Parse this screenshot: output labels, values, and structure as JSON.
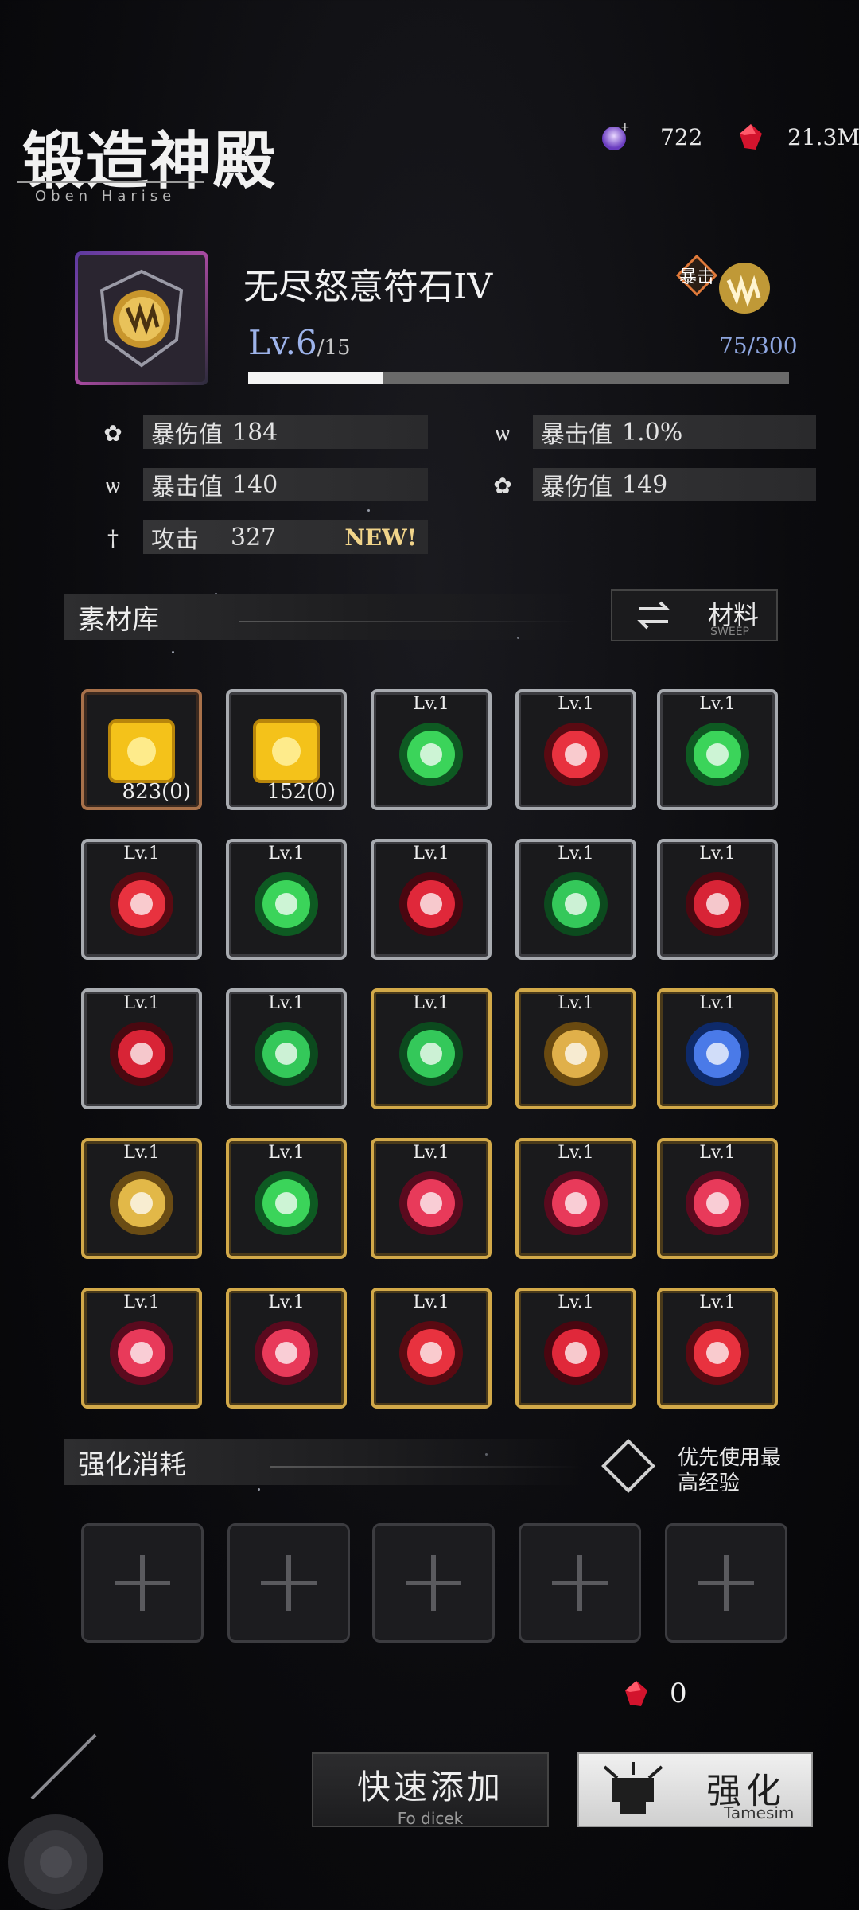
{
  "header": {
    "title": "锻造神殿",
    "subtitle": "Oben Harise"
  },
  "currency": {
    "gem": "722",
    "ruby": "21.3M"
  },
  "item": {
    "name": "无尽怒意符石IV",
    "level": "Lv.6",
    "level_max": "/15",
    "exp": "75/300",
    "exp_progress": 0.25,
    "type_badge": "暴击"
  },
  "stats": {
    "left": [
      {
        "label": "暴伤值",
        "value": "184",
        "icon": "flower-icon"
      },
      {
        "label": "暴击值",
        "value": "140",
        "icon": "claw-icon"
      },
      {
        "label": "攻击",
        "value": "327",
        "icon": "sword-icon",
        "tag": "NEW!"
      }
    ],
    "right": [
      {
        "label": "暴击值",
        "value": "1.0%",
        "icon": "claw-icon"
      },
      {
        "label": "暴伤值",
        "value": "149",
        "icon": "flower-icon"
      }
    ]
  },
  "library": {
    "title": "素材库",
    "sweep_label": "材料",
    "sweep_sub": "SWEEP",
    "cells": [
      {
        "frame": "copper",
        "icon": "gold-cube",
        "count": "823(0)"
      },
      {
        "frame": "silver",
        "icon": "gold-cube",
        "count": "152(0)"
      },
      {
        "frame": "silver",
        "icon": "green-drop",
        "lv": "Lv.1"
      },
      {
        "frame": "silver",
        "icon": "red-diamond",
        "lv": "Lv.1"
      },
      {
        "frame": "silver",
        "icon": "green-drop",
        "lv": "Lv.1"
      },
      {
        "frame": "silver",
        "icon": "red-diamond",
        "lv": "Lv.1"
      },
      {
        "frame": "silver",
        "icon": "green-drop",
        "lv": "Lv.1"
      },
      {
        "frame": "silver",
        "icon": "red-flame",
        "lv": "Lv.1"
      },
      {
        "frame": "silver",
        "icon": "green-swirl",
        "lv": "Lv.1"
      },
      {
        "frame": "silver",
        "icon": "red-tree",
        "lv": "Lv.1"
      },
      {
        "frame": "silver",
        "icon": "red-tree",
        "lv": "Lv.1"
      },
      {
        "frame": "silver",
        "icon": "green-swirl",
        "lv": "Lv.1"
      },
      {
        "frame": "gold",
        "icon": "green-swirl",
        "lv": "Lv.1"
      },
      {
        "frame": "gold",
        "icon": "gold-claw",
        "lv": "Lv.1"
      },
      {
        "frame": "gold",
        "icon": "blue-cross",
        "lv": "Lv.1"
      },
      {
        "frame": "gold",
        "icon": "gold-fist",
        "lv": "Lv.1"
      },
      {
        "frame": "gold",
        "icon": "green-drop",
        "lv": "Lv.1"
      },
      {
        "frame": "gold",
        "icon": "red-spiral",
        "lv": "Lv.1"
      },
      {
        "frame": "gold",
        "icon": "red-spiral",
        "lv": "Lv.1"
      },
      {
        "frame": "gold",
        "icon": "red-spiral",
        "lv": "Lv.1"
      },
      {
        "frame": "gold",
        "icon": "red-spiral",
        "lv": "Lv.1"
      },
      {
        "frame": "gold",
        "icon": "red-spiral",
        "lv": "Lv.1"
      },
      {
        "frame": "gold",
        "icon": "red-diamond",
        "lv": "Lv.1"
      },
      {
        "frame": "gold",
        "icon": "red-flame",
        "lv": "Lv.1"
      },
      {
        "frame": "gold",
        "icon": "red-diamond",
        "lv": "Lv.1"
      }
    ]
  },
  "enhance": {
    "title": "强化消耗",
    "prefer": "优先使用最高经验",
    "cost": "0",
    "quick_label": "快速添加",
    "quick_sub": "Fo dicek",
    "enhance_label": "强化",
    "enhance_sub": "Tamesim"
  }
}
